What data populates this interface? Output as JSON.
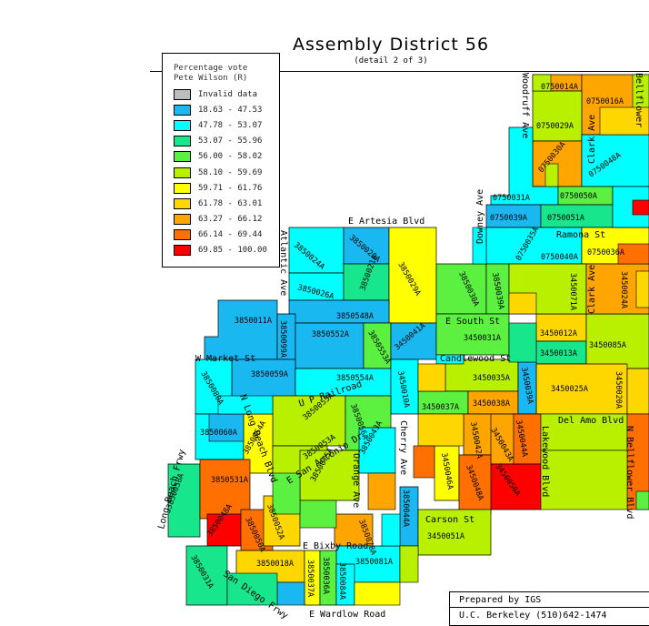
{
  "title": "Assembly District 56",
  "subtitle": "(detail 2 of 3)",
  "legend": {
    "title_line1": "Percentage vote",
    "title_line2": "Pete Wilson (R)",
    "items": [
      {
        "label": "Invalid data",
        "color": "#bdbdbd"
      },
      {
        "label": "18.63 -  47.53",
        "color": "#1ab8f0"
      },
      {
        "label": "47.78 -  53.07",
        "color": "#00ffff"
      },
      {
        "label": "53.07 -  55.96",
        "color": "#17e68c"
      },
      {
        "label": "56.00 -  58.02",
        "color": "#5cf040"
      },
      {
        "label": "58.10 -  59.69",
        "color": "#b8f000"
      },
      {
        "label": "59.71 -  61.76",
        "color": "#ffff00"
      },
      {
        "label": "61.78 -  63.01",
        "color": "#ffd700"
      },
      {
        "label": "63.27 -  66.12",
        "color": "#ffa500"
      },
      {
        "label": "66.14 -  69.44",
        "color": "#ff7000"
      },
      {
        "label": "69.85 - 100.00",
        "color": "#ff0000"
      }
    ]
  },
  "streets": {
    "artesia": "E Artesia Blvd",
    "atlantic": "Atlantic Ave",
    "downey": "Downey Ave",
    "clark": "Clark Ave",
    "clark2": "Clark Ave",
    "ramona": "Ramona St",
    "south": "E South St",
    "candlewood": "Candlewood St",
    "market": "W Market St",
    "lb_blvd": "N Long Beach Blvd",
    "up_railroad": "U P Railroad",
    "san_antonio": "E San Antonio Dr",
    "orange": "Orange Ave",
    "cherry": "Cherry Ave",
    "lakewood": "Lakewood Blvd",
    "del_amo": "Del Amo Blvd",
    "bellflower": "N Bellflower Blvd",
    "carson": "Carson St",
    "bixby": "E Bixby Road",
    "wardlow": "E Wardlow Road",
    "lb_frwy": "Long Beach Frwy",
    "san_diego": "San Diego Frwy",
    "woodruff": "Woodruff Ave",
    "bellflower_top": "Bellflower"
  },
  "precincts": [
    {
      "id": "0750014A",
      "color": "#ffa500"
    },
    {
      "id": "0750016A",
      "color": "#ffa500"
    },
    {
      "id": "0750029A",
      "color": "#b8f000"
    },
    {
      "id": "0750030A",
      "color": "#ffa500"
    },
    {
      "id": "0750048A",
      "color": "#00ffff"
    },
    {
      "id": "0750031A",
      "color": "#00ffff"
    },
    {
      "id": "0750039A",
      "color": "#1ab8f0"
    },
    {
      "id": "0750050A",
      "color": "#5cf040"
    },
    {
      "id": "0750051A",
      "color": "#17e68c"
    },
    {
      "id": "0750040A",
      "color": "#00ffff"
    },
    {
      "id": "0750036A",
      "color": "#ffff00"
    },
    {
      "id": "0750035A",
      "color": "#00ffff"
    },
    {
      "id": "3850024A",
      "color": "#00ffff"
    },
    {
      "id": "3850026A",
      "color": "#00ffff"
    },
    {
      "id": "3850020A",
      "color": "#1ab8f0"
    },
    {
      "id": "3850021A",
      "color": "#17e68c"
    },
    {
      "id": "3850029A",
      "color": "#ffff00"
    },
    {
      "id": "3850030A",
      "color": "#5cf040"
    },
    {
      "id": "3850039A",
      "color": "#5cf040"
    },
    {
      "id": "3850548A",
      "color": "#1ab8f0"
    },
    {
      "id": "3850011A",
      "color": "#1ab8f0"
    },
    {
      "id": "3850099A",
      "color": "#1ab8f0"
    },
    {
      "id": "3850552A",
      "color": "#1ab8f0"
    },
    {
      "id": "3850553A",
      "color": "#5cf040"
    },
    {
      "id": "3450041A",
      "color": "#1ab8f0"
    },
    {
      "id": "3450031A",
      "color": "#5cf040"
    },
    {
      "id": "3450012A",
      "color": "#ffd700"
    },
    {
      "id": "3450013A",
      "color": "#17e68c"
    },
    {
      "id": "3450085A",
      "color": "#b8f000"
    },
    {
      "id": "3450071A",
      "color": "#b8f000"
    },
    {
      "id": "3450024A",
      "color": "#ffa500"
    },
    {
      "id": "3850059A",
      "color": "#1ab8f0"
    },
    {
      "id": "3850080A",
      "color": "#00ffff"
    },
    {
      "id": "3850554A",
      "color": "#00ffff"
    },
    {
      "id": "3450035A",
      "color": "#b8f000"
    },
    {
      "id": "3450025A",
      "color": "#ffd700"
    },
    {
      "id": "3450020A",
      "color": "#ffd700"
    },
    {
      "id": "3450037A",
      "color": "#5cf040"
    },
    {
      "id": "3450038A",
      "color": "#ffa500"
    },
    {
      "id": "3450039A",
      "color": "#1ab8f0"
    },
    {
      "id": "3450010A",
      "color": "#00ffff"
    },
    {
      "id": "3850060A",
      "color": "#00ffff"
    },
    {
      "id": "3850055A",
      "color": "#b8f000"
    },
    {
      "id": "3850056A",
      "color": "#5cf040"
    },
    {
      "id": "3850054A",
      "color": "#ffff00"
    },
    {
      "id": "3850053A",
      "color": "#b8f000"
    },
    {
      "id": "3850075A",
      "color": "#b8f000"
    },
    {
      "id": "3850043A",
      "color": "#00ffff"
    },
    {
      "id": "3450042A",
      "color": "#ffa500"
    },
    {
      "id": "3450043A",
      "color": "#ffa500"
    },
    {
      "id": "3450044A",
      "color": "#ff7000"
    },
    {
      "id": "3450050A",
      "color": "#ff0000"
    },
    {
      "id": "3450046A",
      "color": "#ffff00"
    },
    {
      "id": "3450048A",
      "color": "#ff7000"
    },
    {
      "id": "3850058A",
      "color": "#17e68c"
    },
    {
      "id": "3850531A",
      "color": "#ff7000"
    },
    {
      "id": "3850048A",
      "color": "#ff0000"
    },
    {
      "id": "3850050A",
      "color": "#ff7000"
    },
    {
      "id": "3850052A",
      "color": "#ffd700"
    },
    {
      "id": "3850044A",
      "color": "#1ab8f0"
    },
    {
      "id": "3850078A",
      "color": "#ffa500"
    },
    {
      "id": "3450051A",
      "color": "#b8f000"
    },
    {
      "id": "3850018A",
      "color": "#ffd700"
    },
    {
      "id": "3850081A",
      "color": "#00ffff"
    },
    {
      "id": "3850037A",
      "color": "#ffff00"
    },
    {
      "id": "3850036A",
      "color": "#5cf040"
    },
    {
      "id": "3850084A",
      "color": "#00ffff"
    },
    {
      "id": "3850031A",
      "color": "#17e68c"
    }
  ],
  "credit": {
    "line1": "Prepared by IGS",
    "line2": "U.C. Berkeley (510)642-1474"
  }
}
